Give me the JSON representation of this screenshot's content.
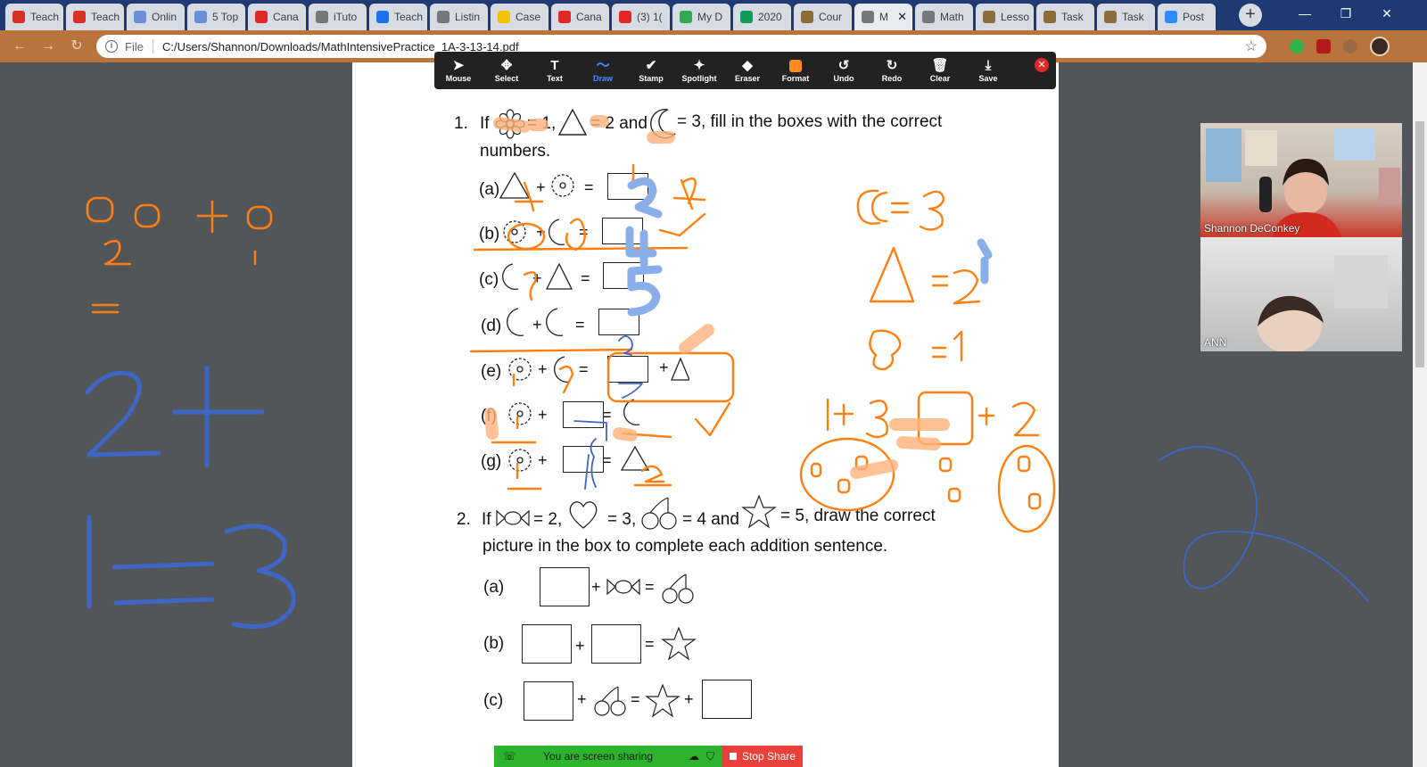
{
  "tabs": [
    {
      "label": "Teach",
      "icon": "i-red-icon",
      "color": "#d93025"
    },
    {
      "label": "Teach",
      "icon": "i-red-icon",
      "color": "#d93025"
    },
    {
      "label": "Onlin",
      "icon": "dt-jobs-icon",
      "color": "#6b8fd6"
    },
    {
      "label": "5 Top",
      "icon": "dt-jobs-icon",
      "color": "#6b8fd6"
    },
    {
      "label": "Cana",
      "icon": "canvas-icon",
      "color": "#e02828"
    },
    {
      "label": "iTuto",
      "icon": "globe-icon",
      "color": "#777777"
    },
    {
      "label": "Teach",
      "icon": "f-icon",
      "color": "#1a73e8"
    },
    {
      "label": "Listin",
      "icon": "globe-icon",
      "color": "#777777"
    },
    {
      "label": "Case",
      "icon": "smile-icon",
      "color": "#f2c200"
    },
    {
      "label": "Cana",
      "icon": "canvas-icon",
      "color": "#e02828"
    },
    {
      "label": "(3) 1(",
      "icon": "youtube-icon",
      "color": "#e02828"
    },
    {
      "label": "My D",
      "icon": "drive-icon",
      "color": "#34a853"
    },
    {
      "label": "2020",
      "icon": "sheets-icon",
      "color": "#0f9d58"
    },
    {
      "label": "Cour",
      "icon": "doc-icon",
      "color": "#8a6d3b"
    },
    {
      "label": "M",
      "icon": "globe-icon",
      "color": "#777777",
      "active": true
    },
    {
      "label": "Math",
      "icon": "globe-icon",
      "color": "#777777"
    },
    {
      "label": "Lesso",
      "icon": "doc-icon",
      "color": "#8a6d3b"
    },
    {
      "label": "Task",
      "icon": "doc-icon",
      "color": "#8a6d3b"
    },
    {
      "label": "Task",
      "icon": "doc-icon",
      "color": "#8a6d3b"
    },
    {
      "label": "Post",
      "icon": "zoom-icon",
      "color": "#2d8cff"
    }
  ],
  "address": {
    "file_label": "File",
    "url": "C:/Users/Shannon/Downloads/MathIntensivePractice_1A-3-13-14.pdf"
  },
  "annotation_toolbar": {
    "tools": [
      {
        "label": "Mouse",
        "icon": "cursor-icon",
        "glyph": "➤"
      },
      {
        "label": "Select",
        "icon": "move-icon",
        "glyph": "✥"
      },
      {
        "label": "Text",
        "icon": "text-icon",
        "glyph": "T"
      },
      {
        "label": "Draw",
        "icon": "draw-icon",
        "glyph": "〜",
        "active": true
      },
      {
        "label": "Stamp",
        "icon": "check-icon",
        "glyph": "✔"
      },
      {
        "label": "Spotlight",
        "icon": "spotlight-icon",
        "glyph": "✦"
      },
      {
        "label": "Eraser",
        "icon": "eraser-icon",
        "glyph": "◆"
      },
      {
        "label": "Format",
        "icon": "format-color-icon",
        "glyph": ""
      },
      {
        "label": "Undo",
        "icon": "undo-icon",
        "glyph": "↺"
      },
      {
        "label": "Redo",
        "icon": "redo-icon",
        "glyph": "↻"
      },
      {
        "label": "Clear",
        "icon": "trash-icon",
        "glyph": "🗑"
      },
      {
        "label": "Save",
        "icon": "save-icon",
        "glyph": "⤓"
      }
    ],
    "format_color": "#ff8c1a"
  },
  "worksheet": {
    "q1_number": "1.",
    "q1_intro_if": "If",
    "q1_eq1": "= 1,",
    "q1_eq2": "= 2 and",
    "q1_eq3": "= 3, fill in the boxes with the correct",
    "q1_line2": "numbers.",
    "q1_parts": [
      "(a)",
      "(b)",
      "(c)",
      "(d)",
      "(e)",
      "(f)",
      "(g)"
    ],
    "q2_number": "2.",
    "q2_intro_if": "If",
    "q2_eq1": "= 2,",
    "q2_eq2": "= 3,",
    "q2_eq3": "= 4 and",
    "q2_eq4": "= 5, draw the correct",
    "q2_line2": "picture in the box to complete each addition sentence.",
    "q2_parts": [
      "(a)",
      "(b)",
      "(c)"
    ]
  },
  "annotations": {
    "orange_color": "#ff7f11",
    "blue_color": "#3f66c5",
    "light_blue_color": "#8aaeea",
    "texts": {
      "a_answer": "3",
      "moon_eq": "= 3",
      "tri_eq": "= 2",
      "flower_eq": "= 1",
      "sum_line": "1+3 = 2 + 2"
    }
  },
  "participants": [
    {
      "name": "Shannon DeConkey"
    },
    {
      "name": "ANN"
    }
  ],
  "share_bar": {
    "status": "You are screen sharing",
    "stop_label": "Stop Share"
  }
}
